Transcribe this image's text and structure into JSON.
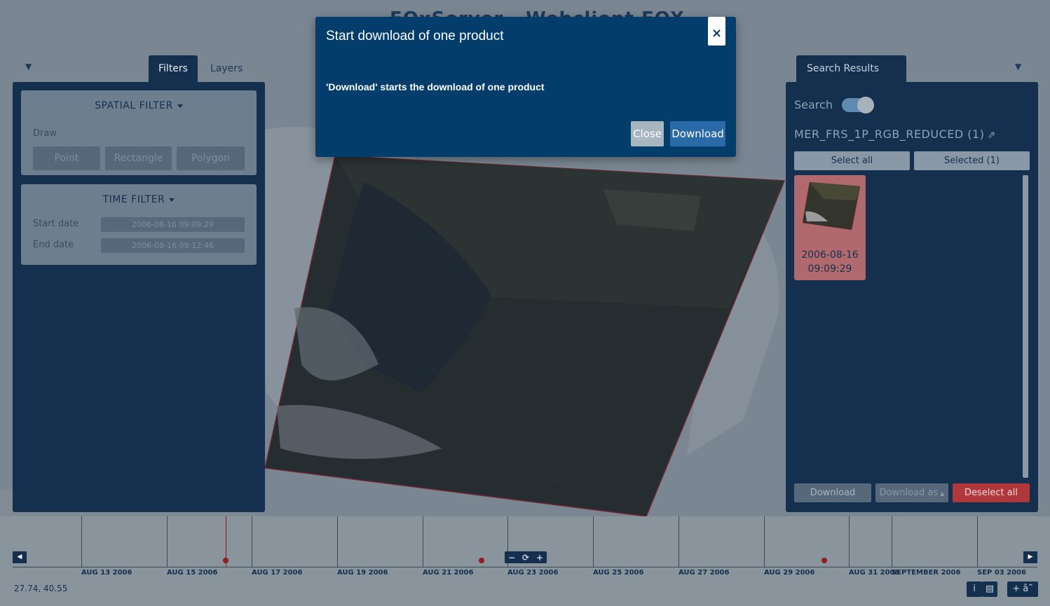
{
  "app": {
    "title": "EOxServer - Webclient EOX"
  },
  "tabs": {
    "filters": "Filters",
    "layers": "Layers",
    "search_results": "Search Results"
  },
  "spatial_filter": {
    "header": "SPATIAL FILTER",
    "draw_label": "Draw",
    "buttons": [
      "Point",
      "Rectangle",
      "Polygon"
    ]
  },
  "time_filter": {
    "header": "TIME FILTER",
    "start_label": "Start date",
    "start_value": "2006-08-16 09:09:29",
    "end_label": "End date",
    "end_value": "2006-08-16 09:12:46"
  },
  "results": {
    "search_label": "Search",
    "search_enabled": true,
    "collection_title": "MER_FRS_1P_RGB_REDUCED (1)",
    "select_all": "Select all",
    "selected": "Selected (1)",
    "items": [
      {
        "date": "2006-08-16",
        "time": "09:09:29",
        "selected": true
      }
    ],
    "download": "Download",
    "download_as": "Download as",
    "deselect_all": "Deselect all"
  },
  "timeline": {
    "labels": [
      "AUG 13 2006",
      "AUG 15 2006",
      "AUG 17 2006",
      "AUG 19 2006",
      "AUG 21 2006",
      "AUG 23 2006",
      "AUG 25 2006",
      "AUG 27 2006",
      "AUG 29 2006",
      "AUG 31 2006",
      "SEPTEMBER 2006",
      "SEP 03 2006"
    ],
    "zoom_out": "−",
    "reset": "⟳",
    "zoom_in": "+"
  },
  "coordinates": "27.74, 40.55",
  "corner_buttons": {
    "info": "i",
    "book": "▤",
    "extra": "+ â˜"
  },
  "modal": {
    "title": "Start download of one product",
    "body": "'Download' starts the download of one product",
    "close_x": "×",
    "close_button": "Close",
    "download_button": "Download"
  },
  "colors": {
    "panel": "#14304e",
    "modal": "#033d6c",
    "danger": "#b0373c",
    "accent": "#2a6aa8"
  }
}
